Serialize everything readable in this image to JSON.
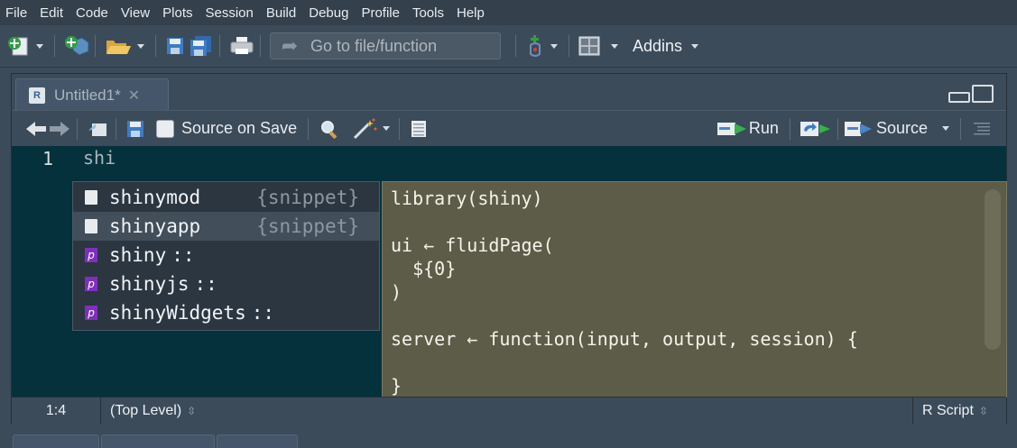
{
  "menu": [
    "File",
    "Edit",
    "Code",
    "View",
    "Plots",
    "Session",
    "Build",
    "Debug",
    "Profile",
    "Tools",
    "Help"
  ],
  "toolbar": {
    "goto_placeholder": "Go to file/function",
    "addins_label": "Addins"
  },
  "editor": {
    "tab_label": "Untitled1*",
    "source_on_save_label": "Source on Save",
    "run_label": "Run",
    "source_label": "Source",
    "line_number": "1",
    "code_text": "shi"
  },
  "autocomplete": {
    "items": [
      {
        "name": "shinymod",
        "suffix": "{snippet}",
        "kind": "snippet"
      },
      {
        "name": "shinyapp",
        "suffix": "{snippet}",
        "kind": "snippet"
      },
      {
        "name": "shiny",
        "suffix": "::",
        "kind": "package"
      },
      {
        "name": "shinyjs",
        "suffix": "::",
        "kind": "package"
      },
      {
        "name": "shinyWidgets",
        "suffix": "::",
        "kind": "package"
      }
    ],
    "package_badge": "p",
    "selected_index": 1
  },
  "preview": {
    "lines": [
      "library(shiny)",
      "",
      "ui ← fluidPage(",
      "  ${0}",
      ")",
      "",
      "server ← function(input, output, session) {",
      "",
      "}"
    ]
  },
  "status": {
    "position": "1:4",
    "scope": "(Top Level)",
    "file_type": "R Script"
  },
  "colors": {
    "code_bg": "#05313c",
    "preview_bg": "#5d5c48",
    "package_badge": "#7f2fbd",
    "run_arrow": "#33b34a"
  }
}
